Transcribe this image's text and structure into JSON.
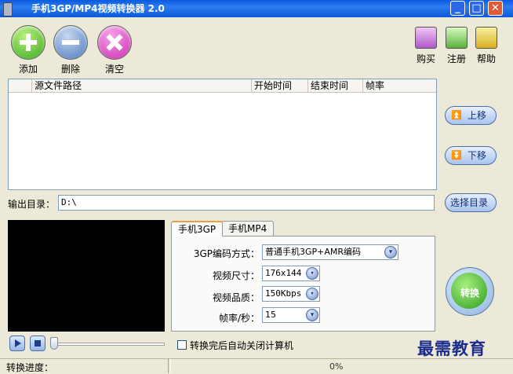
{
  "window": {
    "title": "手机3GP/MP4视频转换器 2.0",
    "min_glyph": "_",
    "max_glyph": "□",
    "close_glyph": "✕"
  },
  "toolbar": {
    "add_label": "添加",
    "delete_label": "删除",
    "clear_label": "清空",
    "buy_label": "购买",
    "register_label": "注册",
    "help_label": "帮助"
  },
  "file_list": {
    "columns": [
      "源文件路径",
      "开始时间",
      "结束时间",
      "帧率"
    ]
  },
  "side_buttons": {
    "up_label": "上移",
    "down_label": "下移",
    "choose_dir_label": "选择目录"
  },
  "output": {
    "label": "输出目录：",
    "value": "D:\\"
  },
  "tabs": {
    "tab1": "手机3GP",
    "tab2": "手机MP4"
  },
  "settings": {
    "codec_label": "3GP编码方式：",
    "codec_value": "普通手机3GP+AMR编码",
    "size_label": "视频尺寸：",
    "size_value": "176x144",
    "quality_label": "视频品质：",
    "quality_value": "150Kbps",
    "fps_label": "帧率/秒：",
    "fps_value": "15"
  },
  "convert_label": "转换",
  "shutdown_label": "转换完后自动关闭计算机",
  "status": {
    "progress_label": "转换进度：",
    "percent": "0%"
  },
  "watermark": "最需教育",
  "colors": {
    "title_bar": "#0a5ae0",
    "window_bg": "#ece9d8",
    "watermark": "#1c2c8c"
  }
}
